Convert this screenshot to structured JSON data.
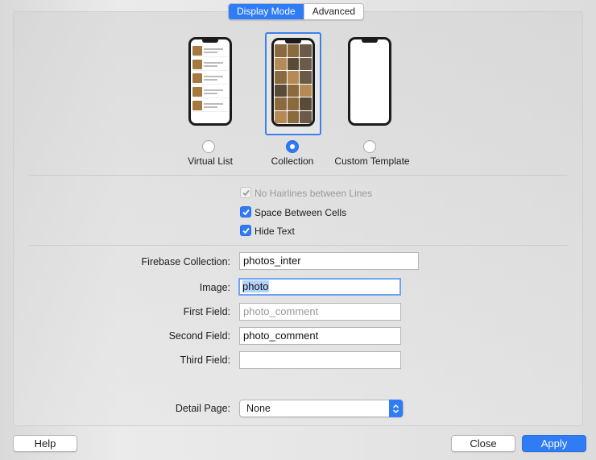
{
  "tabs": {
    "display_mode": "Display Mode",
    "advanced": "Advanced"
  },
  "display_modes": [
    {
      "label": "Virtual List",
      "selected": false
    },
    {
      "label": "Collection",
      "selected": true
    },
    {
      "label": "Custom Template",
      "selected": false
    }
  ],
  "options": {
    "no_hairlines": {
      "label": "No Hairlines between Lines",
      "checked": true,
      "enabled": false
    },
    "space_between": {
      "label": "Space Between Cells",
      "checked": true,
      "enabled": true
    },
    "hide_text": {
      "label": "Hide Text",
      "checked": true,
      "enabled": true
    }
  },
  "form": {
    "firebase_collection": {
      "label": "Firebase Collection:",
      "value": "photos_inter"
    },
    "image": {
      "label": "Image:",
      "value": "photo"
    },
    "first_field": {
      "label": "First Field:",
      "placeholder": "photo_comment"
    },
    "second_field": {
      "label": "Second Field:",
      "value": "photo_comment"
    },
    "third_field": {
      "label": "Third Field:",
      "value": ""
    },
    "detail_page": {
      "label": "Detail Page:",
      "value": "None"
    }
  },
  "buttons": {
    "help": "Help",
    "close": "Close",
    "apply": "Apply"
  },
  "colors": {
    "accent": "#2f7cf6",
    "selection": "#b3d2fb"
  }
}
